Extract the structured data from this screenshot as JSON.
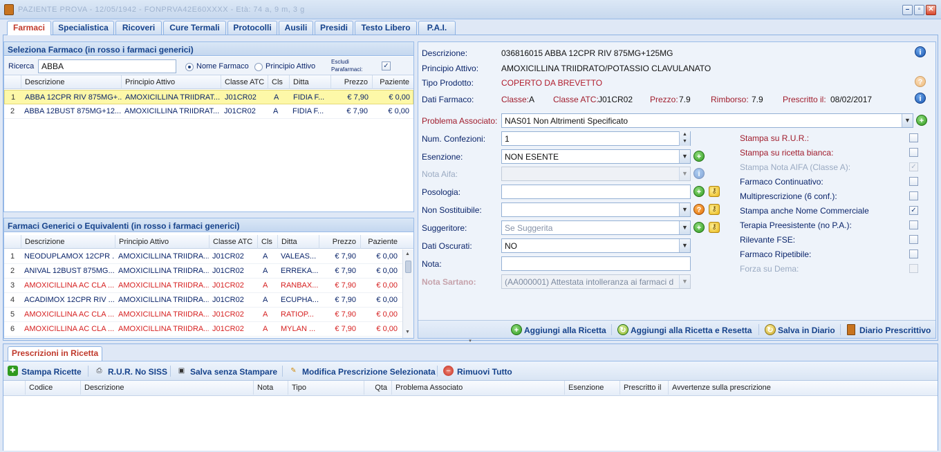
{
  "window": {
    "title": "PAZIENTE PROVA - 12/05/1942 - FONPRVA42E60XXXX - Età: 74 a, 9 m, 3 g"
  },
  "tabs": [
    "Farmaci",
    "Specialistica",
    "Ricoveri",
    "Cure Termali",
    "Protocolli",
    "Ausili",
    "Presidi",
    "Testo Libero",
    "P.A.I."
  ],
  "select_panel": {
    "title": "Seleziona Farmaco (in rosso i farmaci generici)",
    "search_label": "Ricerca",
    "search_value": "ABBA",
    "radio_name": "Nome Farmaco",
    "radio_active": "Principio Attivo",
    "exclude_label": "Escludi Parafarmaci:",
    "exclude_checked": "✓",
    "columns": [
      "Descrizione",
      "Principio Attivo",
      "Classe ATC",
      "Cls",
      "Ditta",
      "Prezzo",
      "Paziente"
    ],
    "rows": [
      {
        "n": "1",
        "desc": "ABBA 12CPR RIV 875MG+...",
        "pa": "AMOXICILLINA TRIIDRAT...",
        "atc": "J01CR02",
        "cls": "A",
        "ditta": "FIDIA F...",
        "prezzo": "€ 7,90",
        "paz": "€ 0,00"
      },
      {
        "n": "2",
        "desc": "ABBA 12BUST 875MG+12...",
        "pa": "AMOXICILLINA TRIIDRAT...",
        "atc": "J01CR02",
        "cls": "A",
        "ditta": "FIDIA F...",
        "prezzo": "€ 7,90",
        "paz": "€ 0,00"
      }
    ]
  },
  "generic_panel": {
    "title": "Farmaci Generici o Equivalenti (in rosso i farmaci generici)",
    "columns": [
      "Descrizione",
      "Principio Attivo",
      "Classe ATC",
      "Cls",
      "Ditta",
      "Prezzo",
      "Paziente"
    ],
    "rows": [
      {
        "n": "1",
        "desc": "NEODUPLAMOX 12CPR ...",
        "pa": "AMOXICILLINA TRIIDRA...",
        "atc": "J01CR02",
        "cls": "A",
        "ditta": "VALEAS...",
        "prezzo": "€ 7,90",
        "paz": "€ 0,00",
        "red": false
      },
      {
        "n": "2",
        "desc": "ANIVAL 12BUST 875MG...",
        "pa": "AMOXICILLINA TRIIDRA...",
        "atc": "J01CR02",
        "cls": "A",
        "ditta": "ERREKA...",
        "prezzo": "€ 7,90",
        "paz": "€ 0,00",
        "red": false
      },
      {
        "n": "3",
        "desc": "AMOXICILLINA AC CLA ...",
        "pa": "AMOXICILLINA TRIIDRA...",
        "atc": "J01CR02",
        "cls": "A",
        "ditta": "RANBAX...",
        "prezzo": "€ 7,90",
        "paz": "€ 0,00",
        "red": true
      },
      {
        "n": "4",
        "desc": "ACADIMOX 12CPR RIV ...",
        "pa": "AMOXICILLINA TRIIDRA...",
        "atc": "J01CR02",
        "cls": "A",
        "ditta": "ECUPHA...",
        "prezzo": "€ 7,90",
        "paz": "€ 0,00",
        "red": false
      },
      {
        "n": "5",
        "desc": "AMOXICILLINA AC CLA ...",
        "pa": "AMOXICILLINA TRIIDRA...",
        "atc": "J01CR02",
        "cls": "A",
        "ditta": "RATIOP...",
        "prezzo": "€ 7,90",
        "paz": "€ 0,00",
        "red": true
      },
      {
        "n": "6",
        "desc": "AMOXICILLINA AC CLA ...",
        "pa": "AMOXICILLINA TRIIDRA...",
        "atc": "J01CR02",
        "cls": "A",
        "ditta": "MYLAN ...",
        "prezzo": "€ 7,90",
        "paz": "€ 0,00",
        "red": true
      }
    ]
  },
  "detail": {
    "descrizione_label": "Descrizione:",
    "descrizione": "036816015 ABBA 12CPR RIV 875MG+125MG",
    "principio_label": "Principio Attivo:",
    "principio": "AMOXICILLINA TRIIDRATO/POTASSIO CLAVULANATO",
    "tipo_label": "Tipo Prodotto:",
    "tipo": "COPERTO DA BREVETTO",
    "dati_label": "Dati Farmaco:",
    "classe_label": "Classe:",
    "classe": "A",
    "atc_label": "Classe ATC:",
    "atc": "J01CR02",
    "prezzo_label": "Prezzo:",
    "prezzo": "7.9",
    "rimborso_label": "Rimborso:",
    "rimborso": "7.9",
    "prescritto_label": "Prescritto il:",
    "prescritto": "08/02/2017",
    "problema_label": "Problema Associato:",
    "problema": "NAS01 Non Altrimenti Specificato",
    "confezioni_label": "Num. Confezioni:",
    "confezioni": "1",
    "esenzione_label": "Esenzione:",
    "esenzione": "NON ESENTE",
    "nota_aifa_label": "Nota Aifa:",
    "posologia_label": "Posologia:",
    "non_sost_label": "Non Sostituibile:",
    "suggeritore_label": "Suggeritore:",
    "suggeritore": "Se Suggerita",
    "oscurati_label": "Dati Oscurati:",
    "oscurati": "NO",
    "nota_label": "Nota:",
    "sartano_label": "Nota Sartano:",
    "sartano": "(AA000001) Attestata intolleranza ai farmaci d"
  },
  "options": [
    {
      "label": "Stampa su R.U.R.:",
      "style": "red",
      "checked": ""
    },
    {
      "label": "Stampa su ricetta bianca:",
      "style": "red",
      "checked": ""
    },
    {
      "label": "Stampa Nota AIFA (Classe A):",
      "style": "dis",
      "checked": "✓"
    },
    {
      "label": "Farmaco Continuativo:",
      "style": "",
      "checked": ""
    },
    {
      "label": "Multiprescrizione (6 conf.):",
      "style": "",
      "checked": ""
    },
    {
      "label": "Stampa anche Nome Commerciale",
      "style": "",
      "checked": "✓"
    },
    {
      "label": "Terapia Preesistente (no P.A.):",
      "style": "",
      "checked": ""
    },
    {
      "label": "Rilevante FSE:",
      "style": "",
      "checked": ""
    },
    {
      "label": "Farmaco Ripetibile:",
      "style": "",
      "checked": ""
    },
    {
      "label": "Forza su Dema:",
      "style": "dis",
      "checked": ""
    }
  ],
  "actions": {
    "aggiungi": "Aggiungi alla Ricetta",
    "aggiungi_reset": "Aggiungi alla Ricetta e Resetta",
    "salva_diario": "Salva in Diario",
    "diario": "Diario Prescrittivo"
  },
  "prescrizioni": {
    "tab": "Prescrizioni in Ricetta",
    "toolbar": {
      "stampa": "Stampa Ricette",
      "rur": "R.U.R. No SISS",
      "salva": "Salva senza Stampare",
      "modifica": "Modifica Prescrizione Selezionata",
      "rimuovi": "Rimuovi Tutto"
    },
    "columns": [
      "Codice",
      "Descrizione",
      "Nota",
      "Tipo",
      "Qta",
      "Problema Associato",
      "Esenzione",
      "Prescritto il",
      "Avvertenze sulla prescrizione"
    ]
  },
  "colors": {
    "accent": "#15428b",
    "generic_red": "#d62020",
    "selection": "#fdf8a8",
    "border": "#99bbe8"
  }
}
